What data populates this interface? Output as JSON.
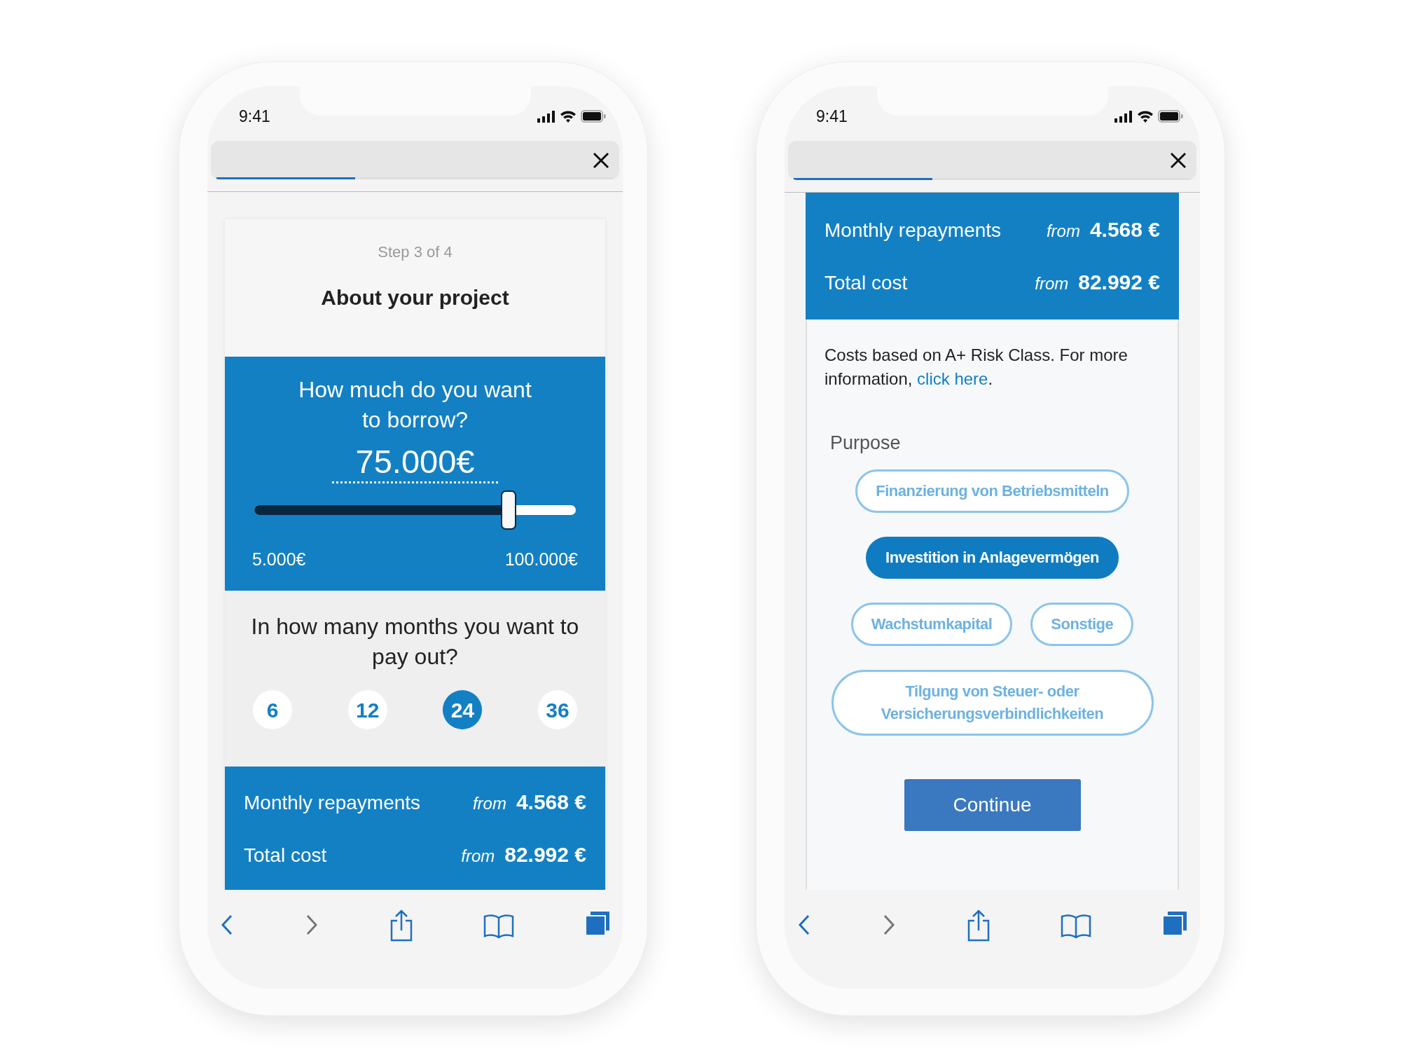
{
  "devices": [
    {
      "status_bar": {
        "time": "9:41"
      },
      "progress": {
        "level": 0.35
      },
      "screen": {
        "kind": "loan_form",
        "step": "Step 3 of 4",
        "title": "About your project",
        "amount": {
          "question": "How much do you want to borrow?",
          "value": "75.000€",
          "slider": {
            "level": 0.79
          },
          "min": "5.000€",
          "max": "100.000€"
        },
        "months": {
          "question": "In how many months you want to pay out?",
          "options": [
            {
              "label": "6",
              "selected": false
            },
            {
              "label": "12",
              "selected": false
            },
            {
              "label": "24",
              "selected": true
            },
            {
              "label": "36",
              "selected": false
            }
          ]
        },
        "summary": [
          {
            "label": "Monthly repayments",
            "prefix": "from",
            "value": "4.568 €"
          },
          {
            "label": "Total cost",
            "prefix": "from",
            "value": "82.992 €"
          }
        ]
      }
    },
    {
      "status_bar": {
        "time": "9:41"
      },
      "progress": {
        "level": 0.35
      },
      "screen": {
        "kind": "purpose_form",
        "summary": [
          {
            "label": "Monthly repayments",
            "prefix": "from",
            "value": "4.568 €"
          },
          {
            "label": "Total cost",
            "prefix": "from",
            "value": "82.992 €"
          }
        ],
        "note": {
          "text": "Costs based on A+ Risk Class. For more information, ",
          "link": "click here",
          "end": "."
        },
        "purpose_label": "Purpose",
        "chip_rows": [
          [
            {
              "label": "Finanzierung von Betriebsmitteln",
              "selected": false
            }
          ],
          [
            {
              "label": "Investition in Anlagevermögen",
              "selected": true
            }
          ],
          [
            {
              "label": "Wachstumkapital",
              "selected": false
            },
            {
              "label": "Sonstige",
              "selected": false
            }
          ],
          [
            {
              "label": "Tilgung von Steuer- oder Versicherungsverbindlichkeiten",
              "selected": false
            }
          ]
        ],
        "button": "Continue"
      }
    }
  ]
}
